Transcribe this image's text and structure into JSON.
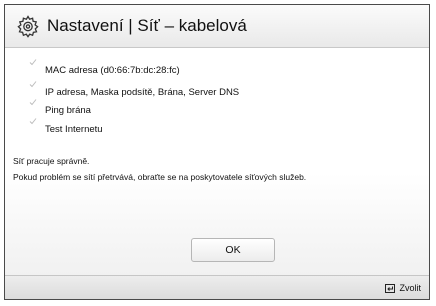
{
  "dialog": {
    "title_icon": "gear-icon",
    "title": "Nastavení | Síť – kabelová"
  },
  "checks": [
    {
      "label": "MAC adresa (d0:66:7b:dc:28:fc)",
      "icon": "check-icon"
    },
    {
      "label": "IP adresa, Maska podsítě, Brána, Server DNS",
      "icon": "check-icon"
    },
    {
      "label": "Ping brána",
      "icon": "check-icon"
    },
    {
      "label": "Test Internetu",
      "icon": "check-icon"
    }
  ],
  "messages": {
    "status": "Síť pracuje správně.",
    "hint": "Pokud problém se sítí přetrvává, obraťte se na poskytovatele síťových služeb."
  },
  "buttons": {
    "ok": "OK"
  },
  "footer": {
    "select_icon": "enter-icon",
    "select_label": "Zvolit"
  },
  "colors": {
    "title_bar": "#eeeeee",
    "border": "#4a4a4a",
    "text": "#111111"
  }
}
